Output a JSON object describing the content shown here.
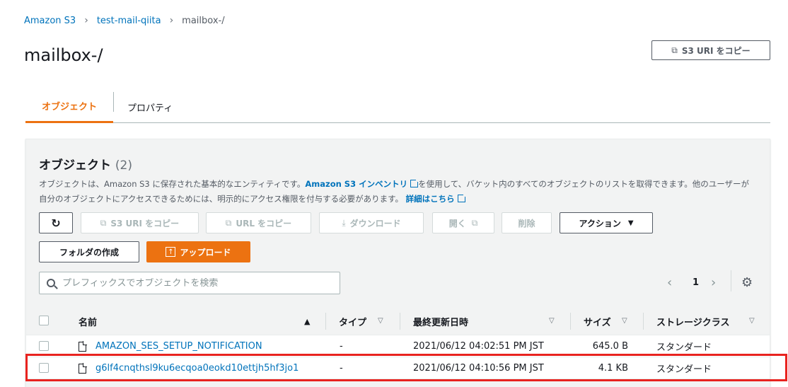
{
  "breadcrumb": {
    "items": [
      "Amazon S3",
      "test-mail-qiita"
    ],
    "current": "mailbox-/"
  },
  "page_title": "mailbox-/",
  "copy_uri_top": "S3 URI をコピー",
  "tabs": [
    "オブジェクト",
    "プロパティ"
  ],
  "panel": {
    "title": "オブジェクト",
    "count": "(2)",
    "desc_1": "オブジェクトは、Amazon S3 に保存された基本的なエンティティです。",
    "desc_link_1": "Amazon S3 インベントリ",
    "desc_2": "を使用して、バケット内のすべてのオブジェクトのリストを取得できます。他のユーザーが自分のオブジェクトにアクセスできるためには、明示的にアクセス権限を付与する必要があります。",
    "desc_link_2": "詳細はこちら"
  },
  "toolbar": {
    "copy_s3_uri": "S3 URI をコピー",
    "copy_url": "URL をコピー",
    "download": "ダウンロード",
    "open": "開く",
    "delete": "削除",
    "actions": "アクション",
    "create_folder": "フォルダの作成",
    "upload": "アップロード"
  },
  "search": {
    "placeholder": "プレフィックスでオブジェクトを検索"
  },
  "pagination": {
    "page": "1"
  },
  "table": {
    "headers": [
      "名前",
      "タイプ",
      "最終更新日時",
      "サイズ",
      "ストレージクラス"
    ],
    "rows": [
      {
        "name": "AMAZON_SES_SETUP_NOTIFICATION",
        "type": "-",
        "modified": "2021/06/12 04:02:51 PM JST",
        "size": "645.0 B",
        "storage": "スタンダード"
      },
      {
        "name": "g6lf4cnqthsl9ku6ecqoa0eokd10ettjh5hf3jo1",
        "type": "-",
        "modified": "2021/06/12 04:10:56 PM JST",
        "size": "4.1 KB",
        "storage": "スタンダード"
      }
    ]
  },
  "colors": {
    "accent": "#ec7211",
    "link": "#0073bb",
    "highlight": "#e8231f"
  }
}
